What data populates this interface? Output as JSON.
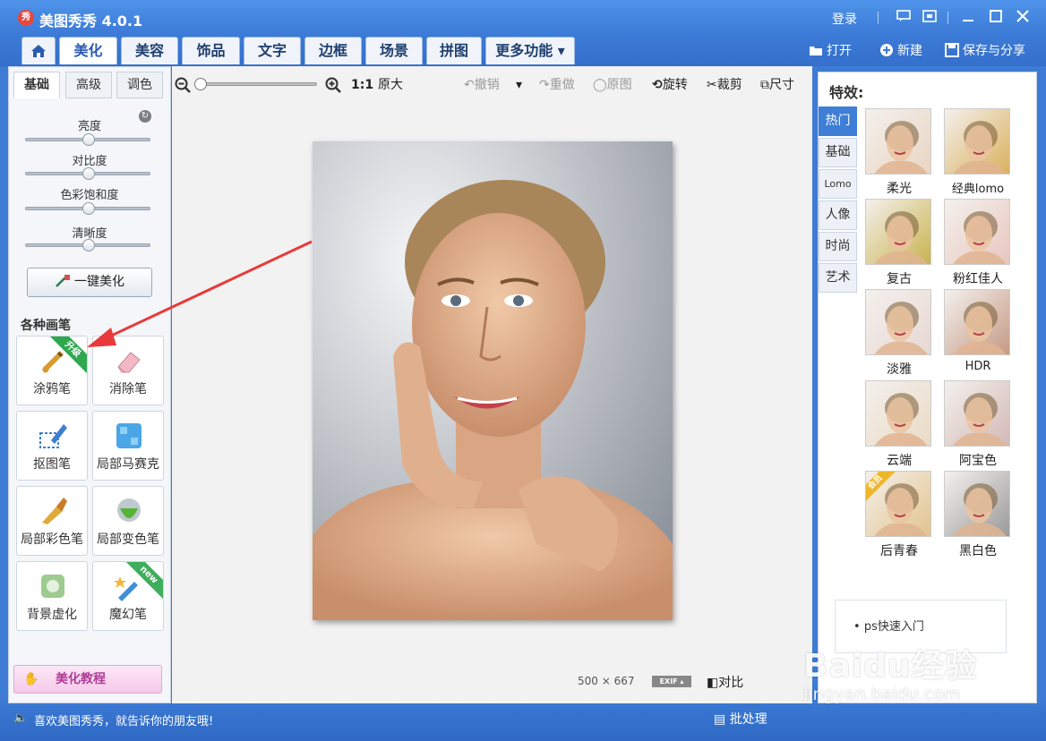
{
  "window": {
    "title": "美图秀秀 4.0.1",
    "login": "登录",
    "logo_char": "秀"
  },
  "main_tabs": [
    {
      "label": "美化",
      "active": true
    },
    {
      "label": "美容"
    },
    {
      "label": "饰品"
    },
    {
      "label": "文字"
    },
    {
      "label": "边框"
    },
    {
      "label": "场景"
    },
    {
      "label": "拼图"
    },
    {
      "label": "更多功能 ▾"
    }
  ],
  "file_actions": {
    "open": "打开",
    "new": "新建",
    "save_share": "保存与分享"
  },
  "left_panel": {
    "sub_tabs": [
      "基础",
      "高级",
      "调色"
    ],
    "sliders": [
      {
        "label": "亮度",
        "value": 0.5
      },
      {
        "label": "对比度",
        "value": 0.5
      },
      {
        "label": "色彩饱和度",
        "value": 0.5
      },
      {
        "label": "清晰度",
        "value": 0.5
      }
    ],
    "one_click": "一键美化",
    "brushes_title": "各种画笔",
    "brushes": [
      {
        "label": "涂鸦笔",
        "badge": "升级",
        "icon": "paint-brush-icon"
      },
      {
        "label": "消除笔",
        "icon": "eraser-icon"
      },
      {
        "label": "抠图笔",
        "icon": "cutout-pen-icon"
      },
      {
        "label": "局部马赛克",
        "icon": "mosaic-icon"
      },
      {
        "label": "局部彩色笔",
        "icon": "color-brush-icon"
      },
      {
        "label": "局部变色笔",
        "icon": "color-change-icon"
      },
      {
        "label": "背景虚化",
        "icon": "blur-background-icon"
      },
      {
        "label": "魔幻笔",
        "badge": "new",
        "icon": "magic-pen-icon"
      }
    ],
    "tutorial": "美化教程"
  },
  "canvas": {
    "zoom_level": 0.0,
    "original_size": "1:1",
    "original_size_suffix": "原大",
    "undo": "撤销",
    "redo": "重做",
    "original": "原图",
    "rotate": "旋转",
    "crop": "裁剪",
    "resize": "尺寸",
    "image_size": "500 × 667",
    "exif": "EXIF ▴",
    "compare": "对比"
  },
  "effects": {
    "title": "特效:",
    "categories": [
      "热门",
      "基础",
      "Lomo",
      "人像",
      "时尚",
      "艺术"
    ],
    "items": [
      {
        "label": "柔光",
        "tint": "#e9d5c3"
      },
      {
        "label": "经典lomo",
        "tint": "#d9b15e"
      },
      {
        "label": "复古",
        "tint": "#c9b34f"
      },
      {
        "label": "粉红佳人",
        "tint": "#e8c7c0"
      },
      {
        "label": "淡雅",
        "tint": "#e7d8d4"
      },
      {
        "label": "HDR",
        "tint": "#c49a85"
      },
      {
        "label": "云端",
        "tint": "#eadbc6"
      },
      {
        "label": "阿宝色",
        "tint": "#d2b9b6"
      },
      {
        "label": "后青春",
        "tint": "#e2c48d",
        "badge": "会员"
      },
      {
        "label": "黑白色",
        "tint": "#9a9a9a"
      }
    ],
    "tips_link": "ps快速入门"
  },
  "status": {
    "message": "喜欢美图秀秀，就告诉你的朋友哦!",
    "batch": "批处理"
  },
  "watermark": {
    "line1": "Baidu经验",
    "line2": "jingyan.baidu.com"
  },
  "colors": {
    "accent": "#3b7ad6",
    "active_tab": "#3f7ed6",
    "arrow": "#e83a3a"
  }
}
